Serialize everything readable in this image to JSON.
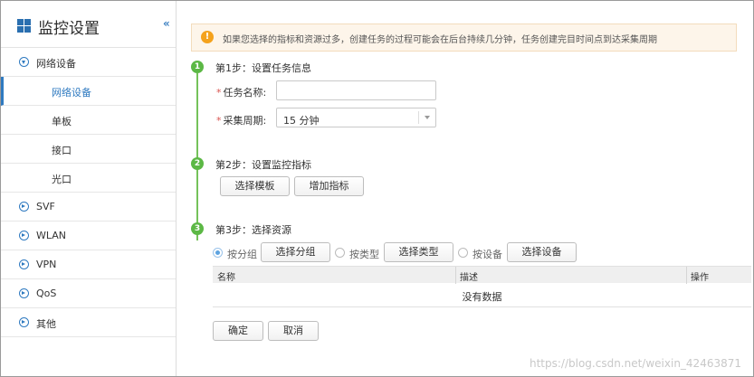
{
  "sidebar": {
    "title": "监控设置",
    "collapse_icon": "«",
    "items": [
      {
        "label": "网络设备",
        "expanded": true
      },
      {
        "label": "SVF"
      },
      {
        "label": "WLAN"
      },
      {
        "label": "VPN"
      },
      {
        "label": "QoS"
      },
      {
        "label": "其他"
      }
    ],
    "subitems": [
      {
        "label": "网络设备",
        "active": true
      },
      {
        "label": "单板"
      },
      {
        "label": "接口"
      },
      {
        "label": "光口"
      }
    ]
  },
  "notice": {
    "icon": "!",
    "text": "如果您选择的指标和资源过多，创建任务的过程可能会在后台持续几分钟，任务创建完目时间点到达采集周期"
  },
  "steps": [
    {
      "num": "1",
      "title": "第1步：设置任务信息"
    },
    {
      "num": "2",
      "title": "第2步：设置监控指标"
    },
    {
      "num": "3",
      "title": "第3步：选择资源"
    }
  ],
  "form": {
    "required_mark": "*",
    "task_name_label": "任务名称:",
    "task_name_value": "",
    "period_label": "采集周期:",
    "period_value": "15 分钟"
  },
  "step2": {
    "select_template": "选择模板",
    "add_metric": "增加指标"
  },
  "step3": {
    "by_group": "按分组",
    "select_group": "选择分组",
    "by_type": "按类型",
    "select_type": "选择类型",
    "by_device": "按设备",
    "select_device": "选择设备",
    "selected": "by_group"
  },
  "table": {
    "columns": [
      "名称",
      "描述",
      "操作"
    ],
    "empty_text": "没有数据"
  },
  "actions": {
    "confirm": "确定",
    "cancel": "取消"
  },
  "watermark": "https://blog.csdn.net/weixin_42463871",
  "colors": {
    "accent": "#2f7ac0",
    "step_green": "#5cb845",
    "warning": "#f4a21d",
    "notice_bg": "#fdf5ea"
  }
}
